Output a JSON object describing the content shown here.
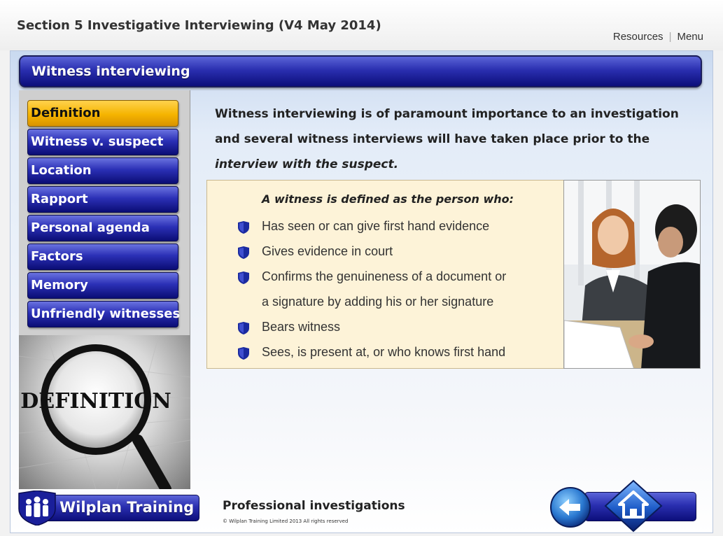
{
  "course": {
    "title": "Section 5 Investigative Interviewing (V4 May 2014)"
  },
  "top_links": {
    "resources": "Resources",
    "separator": "|",
    "menu": "Menu"
  },
  "header": {
    "title": "Witness interviewing"
  },
  "sidebar": {
    "items": [
      {
        "label": "Definition",
        "active": true
      },
      {
        "label": "Witness v. suspect",
        "active": false
      },
      {
        "label": "Location",
        "active": false
      },
      {
        "label": "Rapport",
        "active": false
      },
      {
        "label": "Personal agenda",
        "active": false
      },
      {
        "label": "Factors",
        "active": false
      },
      {
        "label": "Memory",
        "active": false
      },
      {
        "label": "Unfriendly witnesses",
        "active": false
      }
    ],
    "graphic_word": "DEFINITION"
  },
  "content": {
    "intro_line1": "Witness interviewing is of paramount importance to an investigation",
    "intro_line2": "and several witness interviews will have taken place prior to the",
    "intro_line3": "interview with the suspect.",
    "card_title": "A witness is defined as the person who:",
    "bullets": [
      "Has seen or can give first hand evidence",
      "Gives evidence in court",
      "Confirms the genuineness of a document or",
      "a signature by adding his or her signature",
      "Bears witness",
      "Sees, is present at, or who knows first hand"
    ]
  },
  "footer": {
    "brand": "Wilplan Training",
    "title": "Professional investigations",
    "copyright": "© Wilplan Training Limited 2013 All rights reserved"
  },
  "colors": {
    "nav_blue": "#2a2fb0",
    "active_yellow": "#f5b400",
    "card_bg": "#fdf3d8",
    "bullet_blue": "#1a2aa0"
  },
  "icons": {
    "bullet": "shield-bullet-icon",
    "back": "back-arrow-icon",
    "home": "home-icon",
    "brand": "people-shield-icon",
    "graphic": "magnifying-glass-icon"
  }
}
